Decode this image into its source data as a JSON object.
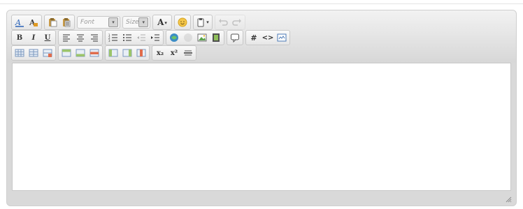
{
  "toolbar": {
    "font_select": {
      "label": "Font"
    },
    "size_select": {
      "label": "Size"
    },
    "bold_label": "B",
    "italic_label": "I",
    "underline_label": "U",
    "text_color_label": "A",
    "anchor_label": "#",
    "source_label": "<>",
    "subscript_label": "x₂",
    "superscript_label": "x²"
  },
  "icons": {
    "row1": [
      "font-color-icon",
      "font-highlight-icon",
      "paste-icon",
      "paste-text-icon",
      "font-select",
      "size-select",
      "text-color-icon",
      "emoticon-icon",
      "paste-dropdown-icon",
      "undo-icon",
      "redo-icon"
    ],
    "row2": [
      "bold-icon",
      "italic-icon",
      "underline-icon",
      "align-left-icon",
      "align-center-icon",
      "align-right-icon",
      "numbered-list-icon",
      "bullet-list-icon",
      "outdent-icon",
      "indent-icon",
      "link-icon",
      "unlink-icon",
      "image-icon",
      "media-icon",
      "comment-icon",
      "anchor-icon",
      "source-code-icon",
      "special-char-icon"
    ],
    "row3": [
      "table-icon",
      "table-properties-icon",
      "delete-table-icon",
      "insert-row-above-icon",
      "insert-row-below-icon",
      "delete-row-icon",
      "insert-column-left-icon",
      "insert-column-right-icon",
      "delete-column-icon",
      "subscript-icon",
      "superscript-icon",
      "horizontal-rule-icon"
    ]
  },
  "colors": {
    "toolbar_bg": "#e4e4e4",
    "editor_bg": "#d9d9d9",
    "content_bg": "#ffffff"
  }
}
